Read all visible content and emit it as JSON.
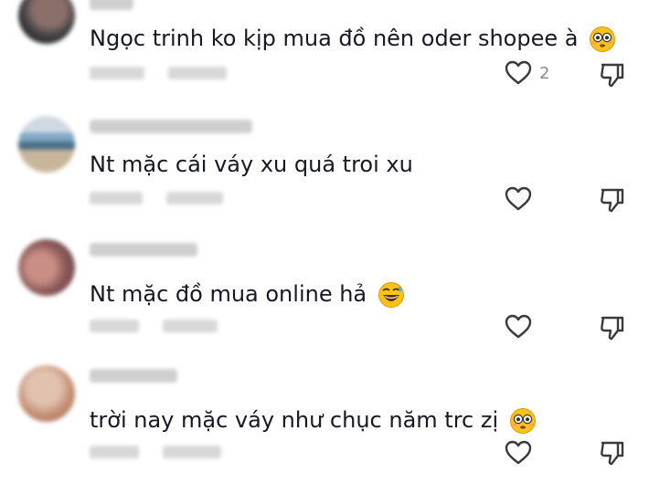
{
  "comments": [
    {
      "text": "Ngọc trinh ko kịp mua đồ nên oder shopee à",
      "emoji": "flushed-face-icon",
      "likes": "2"
    },
    {
      "text": "Nt mặc cái váy xu quá troi xu",
      "emoji": "",
      "likes": ""
    },
    {
      "text": "Nt mặc đồ mua online hả",
      "emoji": "grinning-sweat-face-icon",
      "likes": ""
    },
    {
      "text": "trời nay mặc váy như chục năm trc zị",
      "emoji": "flushed-face-icon",
      "likes": ""
    }
  ],
  "colors": {
    "text": "#161823",
    "icon": "#3a3a3a",
    "meta": "#8a8b91"
  }
}
